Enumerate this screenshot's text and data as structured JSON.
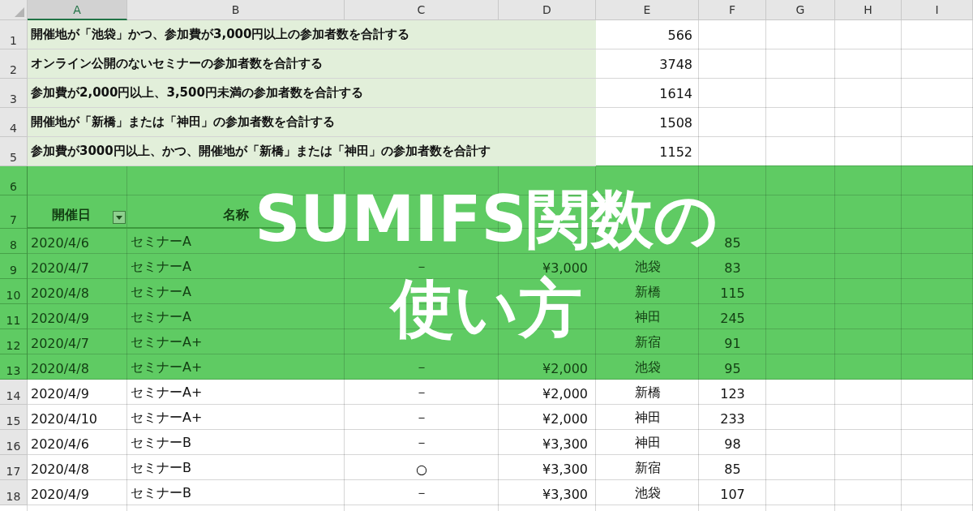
{
  "columns": [
    {
      "label": "A",
      "selected": true
    },
    {
      "label": "B",
      "selected": false
    },
    {
      "label": "C",
      "selected": false
    },
    {
      "label": "D",
      "selected": false
    },
    {
      "label": "E",
      "selected": false
    },
    {
      "label": "F",
      "selected": false
    },
    {
      "label": "G",
      "selected": false
    },
    {
      "label": "H",
      "selected": false
    },
    {
      "label": "I",
      "selected": false
    }
  ],
  "rows": [
    {
      "kind": "note",
      "number": "1",
      "text": "開催地が「池袋」かつ、参加費が3,000円以上の参加者数を合計する",
      "total": "566"
    },
    {
      "kind": "note",
      "number": "2",
      "text": "オンライン公開のないセミナーの参加者数を合計する",
      "total": "3748"
    },
    {
      "kind": "note",
      "number": "3",
      "text": "参加費が2,000円以上、3,500円未満の参加者数を合計する",
      "total": "1614"
    },
    {
      "kind": "note",
      "number": "4",
      "text": "開催地が「新橋」または「神田」の参加者数を合計する",
      "total": "1508"
    },
    {
      "kind": "note",
      "number": "5",
      "text": "参加費が3000円以上、かつ、開催地が「新橋」または「神田」の参加者数を合計す",
      "total": "1152"
    },
    {
      "kind": "blank",
      "number": "6"
    },
    {
      "kind": "header",
      "number": "7",
      "labels": [
        "開催日",
        "名称"
      ]
    },
    {
      "kind": "data",
      "number": "8",
      "date": "2020/4/6",
      "name": "セミナーA",
      "count": "85"
    },
    {
      "kind": "data",
      "number": "9",
      "date": "2020/4/7",
      "name": "セミナーA",
      "online": "－",
      "fee": "¥3,000",
      "place": "池袋",
      "count": "83"
    },
    {
      "kind": "data",
      "number": "10",
      "date": "2020/4/8",
      "name": "セミナーA",
      "place": "新橋",
      "count": "115"
    },
    {
      "kind": "data",
      "number": "11",
      "date": "2020/4/9",
      "name": "セミナーA",
      "place": "神田",
      "count": "245"
    },
    {
      "kind": "data",
      "number": "12",
      "date": "2020/4/7",
      "name": "セミナーA+",
      "place": "新宿",
      "count": "91"
    },
    {
      "kind": "data",
      "number": "13",
      "date": "2020/4/8",
      "name": "セミナーA+",
      "online": "－",
      "fee": "¥2,000",
      "place": "池袋",
      "count": "95"
    },
    {
      "kind": "data",
      "number": "14",
      "date": "2020/4/9",
      "name": "セミナーA+",
      "online": "－",
      "fee": "¥2,000",
      "place": "新橋",
      "count": "123"
    },
    {
      "kind": "data",
      "number": "15",
      "date": "2020/4/10",
      "name": "セミナーA+",
      "online": "－",
      "fee": "¥2,000",
      "place": "神田",
      "count": "233"
    },
    {
      "kind": "data",
      "number": "16",
      "date": "2020/4/6",
      "name": "セミナーB",
      "online": "－",
      "fee": "¥3,300",
      "place": "神田",
      "count": "98"
    },
    {
      "kind": "data",
      "number": "17",
      "date": "2020/4/8",
      "name": "セミナーB",
      "online": "○",
      "fee": "¥3,300",
      "place": "新宿",
      "count": "85"
    },
    {
      "kind": "data",
      "number": "18",
      "date": "2020/4/9",
      "name": "セミナーB",
      "online": "－",
      "fee": "¥3,300",
      "place": "池袋",
      "count": "107"
    }
  ],
  "banner": {
    "lines": [
      "SUMIFS関数の",
      "使い方"
    ]
  }
}
